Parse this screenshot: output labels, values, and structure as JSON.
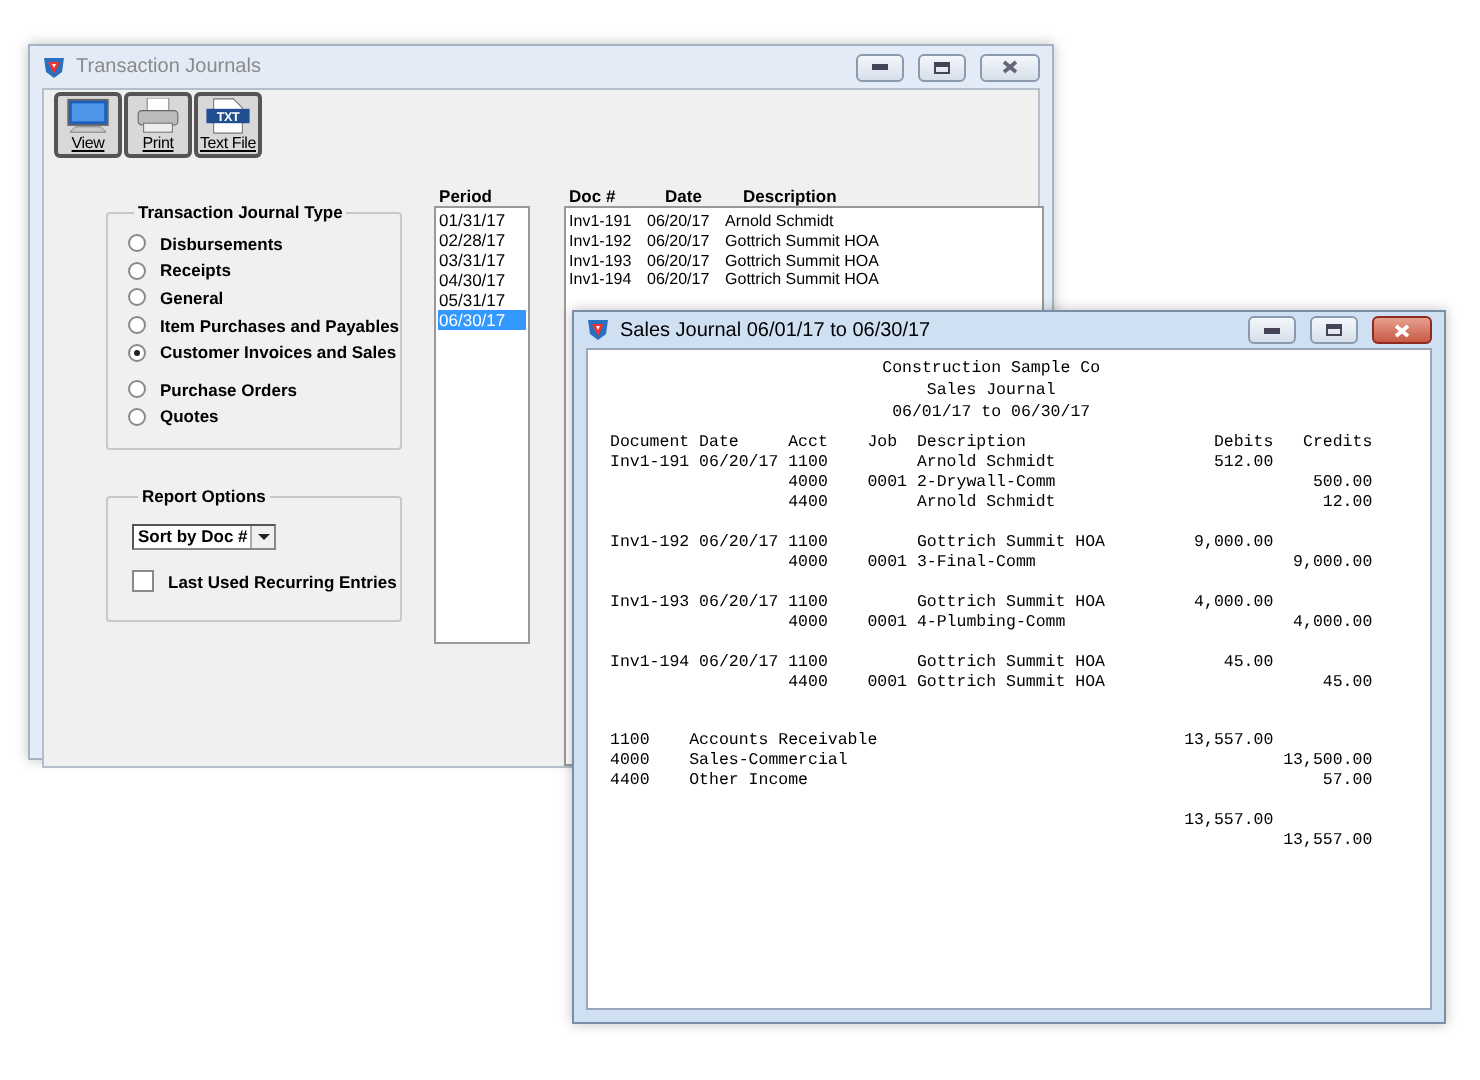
{
  "main_window": {
    "title": "Transaction Journals",
    "toolbar": [
      {
        "kind": "monitor",
        "label": "View"
      },
      {
        "kind": "printer",
        "label": "Print"
      },
      {
        "kind": "textfile",
        "label": "Text File",
        "badge": "TXT"
      }
    ],
    "journal_type": {
      "title": "Transaction Journal Type",
      "options": [
        {
          "label": "Disbursements",
          "selected": false
        },
        {
          "label": "Receipts",
          "selected": false
        },
        {
          "label": "General",
          "selected": false
        },
        {
          "label": "Item Purchases and Payables",
          "selected": false
        },
        {
          "label": "Customer Invoices and Sales",
          "selected": true
        },
        {
          "label": "Purchase Orders",
          "selected": false
        },
        {
          "label": "Quotes",
          "selected": false
        }
      ]
    },
    "report_options": {
      "title": "Report Options",
      "sort": {
        "value": "Sort by Doc #"
      },
      "recurring": {
        "label": "Last Used Recurring Entries",
        "checked": false
      }
    },
    "period": {
      "heading": "Period",
      "items": [
        {
          "label": "01/31/17",
          "selected": false
        },
        {
          "label": "02/28/17",
          "selected": false
        },
        {
          "label": "03/31/17",
          "selected": false
        },
        {
          "label": "04/30/17",
          "selected": false
        },
        {
          "label": "05/31/17",
          "selected": false
        },
        {
          "label": "06/30/17",
          "selected": true
        }
      ]
    },
    "documents": {
      "columns": [
        "Doc #",
        "Date",
        "Description"
      ],
      "rows": [
        [
          "Inv1-191",
          "06/20/17",
          "Arnold Schmidt"
        ],
        [
          "Inv1-192",
          "06/20/17",
          "Gottrich Summit HOA"
        ],
        [
          "Inv1-193",
          "06/20/17",
          "Gottrich Summit HOA"
        ],
        [
          "Inv1-194",
          "06/20/17",
          "Gottrich Summit HOA"
        ]
      ]
    }
  },
  "report_window": {
    "title": "Sales Journal 06/01/17 to 06/30/17",
    "header": [
      "Construction Sample Co",
      "Sales Journal",
      "06/01/17 to 06/30/17"
    ],
    "columns": [
      "Document",
      "Date",
      "Acct",
      "Job",
      "Description",
      "Debits",
      "Credits"
    ],
    "entries": [
      {
        "lines": [
          {
            "document": "Inv1-191",
            "date": "06/20/17",
            "acct": "1100",
            "description": "Arnold Schmidt",
            "debit": "512.00"
          },
          {
            "acct": "4000",
            "job": "0001",
            "description": "2-Drywall-Comm",
            "credit": "500.00"
          },
          {
            "acct": "4400",
            "description": "Arnold Schmidt",
            "credit": "12.00"
          }
        ]
      },
      {
        "lines": [
          {
            "document": "Inv1-192",
            "date": "06/20/17",
            "acct": "1100",
            "description": "Gottrich Summit HOA",
            "debit": "9,000.00"
          },
          {
            "acct": "4000",
            "job": "0001",
            "description": "3-Final-Comm",
            "credit": "9,000.00"
          }
        ]
      },
      {
        "lines": [
          {
            "document": "Inv1-193",
            "date": "06/20/17",
            "acct": "1100",
            "description": "Gottrich Summit HOA",
            "debit": "4,000.00"
          },
          {
            "acct": "4000",
            "job": "0001",
            "description": "4-Plumbing-Comm",
            "credit": "4,000.00"
          }
        ]
      },
      {
        "lines": [
          {
            "document": "Inv1-194",
            "date": "06/20/17",
            "acct": "1100",
            "description": "Gottrich Summit HOA",
            "debit": "45.00"
          },
          {
            "acct": "4400",
            "job": "0001",
            "description": "Gottrich Summit HOA",
            "credit": "45.00"
          }
        ]
      }
    ],
    "summary": [
      {
        "acct": "1100",
        "name": "Accounts Receivable",
        "debit": "13,557.00"
      },
      {
        "acct": "4000",
        "name": "Sales-Commercial",
        "credit": "13,500.00"
      },
      {
        "acct": "4400",
        "name": "Other Income",
        "credit": "57.00"
      }
    ],
    "totals": [
      {
        "debit": "13,557.00"
      },
      {
        "credit": "13,557.00"
      }
    ]
  }
}
